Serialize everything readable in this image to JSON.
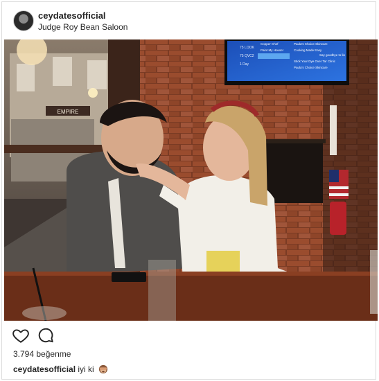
{
  "post": {
    "username": "ceydatesofficial",
    "location": "Judge Roy Bean Saloon",
    "likes_count": "3.794",
    "likes_label": "beğenme",
    "caption": {
      "username": "ceydatesofficial",
      "text": "iyi ki"
    }
  },
  "photo": {
    "sign_text": "EMPIRE",
    "tv_lines": [
      "Copper Chef",
      "Paula's Choice Skincare",
      "Cooking Made Easy",
      "Say goodbye to lin",
      "Paint My House!",
      "Stick Your Dye Over Tar Clinic",
      "Paula's Choice Skincare"
    ],
    "tv_channels": [
      "75 LOOK",
      "75 QVC2",
      "1 Day"
    ]
  },
  "icons": {
    "like": "heart-icon",
    "comment": "comment-bubble-icon",
    "emoji": "see-no-evil-monkey-emoji"
  }
}
